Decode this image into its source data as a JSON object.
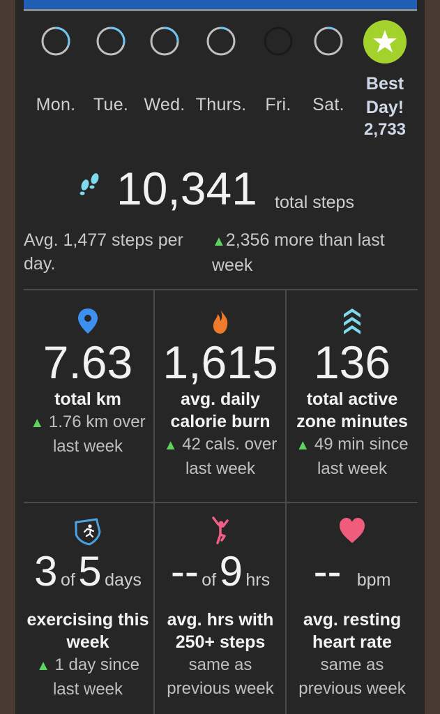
{
  "week": {
    "days": [
      {
        "label": "Mon.",
        "progress": 0.3
      },
      {
        "label": "Tue.",
        "progress": 0.28
      },
      {
        "label": "Wed.",
        "progress": 0.25
      },
      {
        "label": "Thurs.",
        "progress": 0.07
      },
      {
        "label": "Fri.",
        "progress": 0.0
      },
      {
        "label": "Sat.",
        "progress": 0.06
      }
    ],
    "best_title_1": "Best",
    "best_title_2": "Day!",
    "best_value": "2,733"
  },
  "steps": {
    "total": "10,341",
    "unit": "total steps",
    "avg_text": "Avg. 1,477 steps per day.",
    "change_text": "2,356 more than last week"
  },
  "tiles": {
    "distance": {
      "value": "7.63",
      "title": "total km",
      "sub1": "1.76 km over",
      "sub2": "last week"
    },
    "calories": {
      "value": "1,615",
      "title1": "avg. daily",
      "title2": "calorie burn",
      "sub1": "42 cals. over",
      "sub2": "last week"
    },
    "azm": {
      "value": "136",
      "title1": "total active",
      "title2": "zone minutes",
      "sub1": "49 min since",
      "sub2": "last week"
    },
    "exercise": {
      "done": "3",
      "of": "of",
      "goal": "5",
      "unit": "days",
      "title1": "exercising this",
      "title2": "week",
      "sub1": "1 day since",
      "sub2": "last week"
    },
    "hourly": {
      "done": "--",
      "of": "of",
      "goal": "9",
      "unit": "hrs",
      "title1": "avg. hrs with",
      "title2": "250+ steps",
      "sub1": "same as",
      "sub2": "previous week"
    },
    "heart": {
      "value": "--",
      "unit": "bpm",
      "title1": "avg. resting",
      "title2": "heart rate",
      "sub1": "same as",
      "sub2": "previous week"
    }
  },
  "icons": {
    "up_arrow": "▲",
    "star": "★"
  },
  "colors": {
    "ring_track": "#1a1a1a",
    "ring_progress": "#6ec4f0",
    "best_green": "#a3d22c",
    "location_blue": "#3d8ff0",
    "fire_orange": "#f07a2c",
    "azm_cyan": "#7fd9ef",
    "exercise_blue": "#4aa3e0",
    "hourly_pink": "#f06086",
    "heart_pink": "#ef5c7c",
    "up_green": "#5ed35e"
  }
}
